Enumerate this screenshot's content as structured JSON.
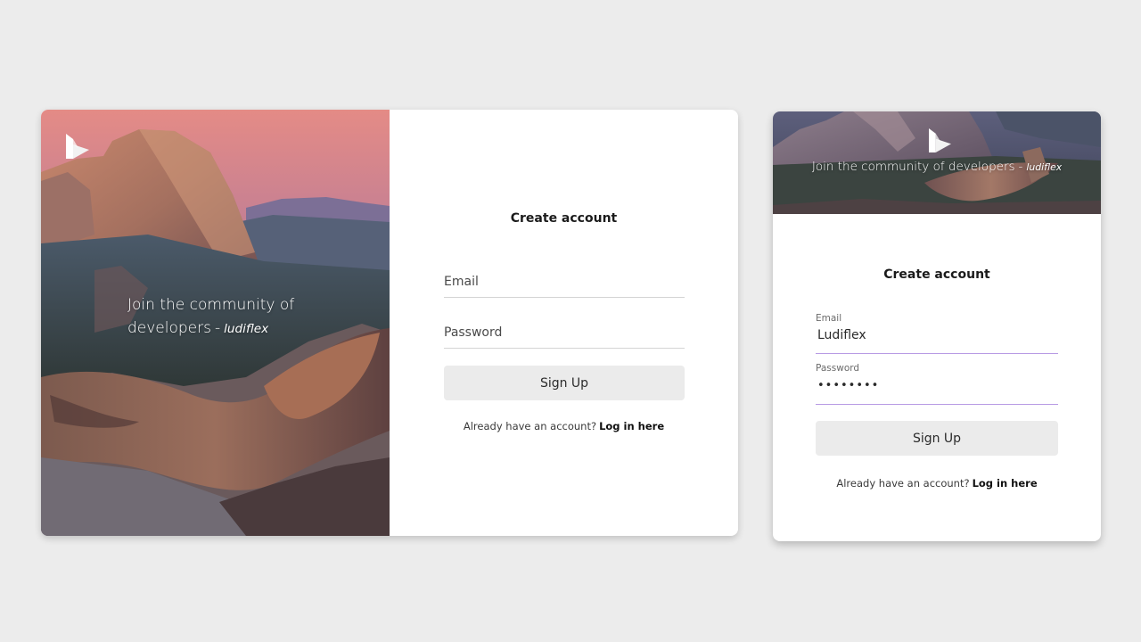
{
  "desktop": {
    "hero": {
      "tagline": "Join the community of developers",
      "separator": "-",
      "brand": "ludiflex",
      "logo_icon": "ludiflex-logo-icon"
    },
    "form": {
      "title": "Create account",
      "email_placeholder": "Email",
      "password_placeholder": "Password",
      "signup_label": "Sign Up",
      "login_prompt": "Already have an account?",
      "login_link": "Log in here"
    }
  },
  "mobile": {
    "hero": {
      "tagline": "Join the community of developers",
      "separator": "-",
      "brand": "ludiflex",
      "logo_icon": "ludiflex-logo-icon"
    },
    "form": {
      "title": "Create account",
      "email_label": "Email",
      "email_value": "Ludiflex",
      "password_label": "Password",
      "password_value": "********",
      "signup_label": "Sign Up",
      "login_prompt": "Already have an account?",
      "login_link": "Log in here"
    }
  },
  "colors": {
    "page_background": "#ececec",
    "card_background": "#ffffff",
    "button_background": "#ebebeb",
    "active_field_underline": "#b89ae4",
    "field_underline": "#d4d4d4"
  }
}
